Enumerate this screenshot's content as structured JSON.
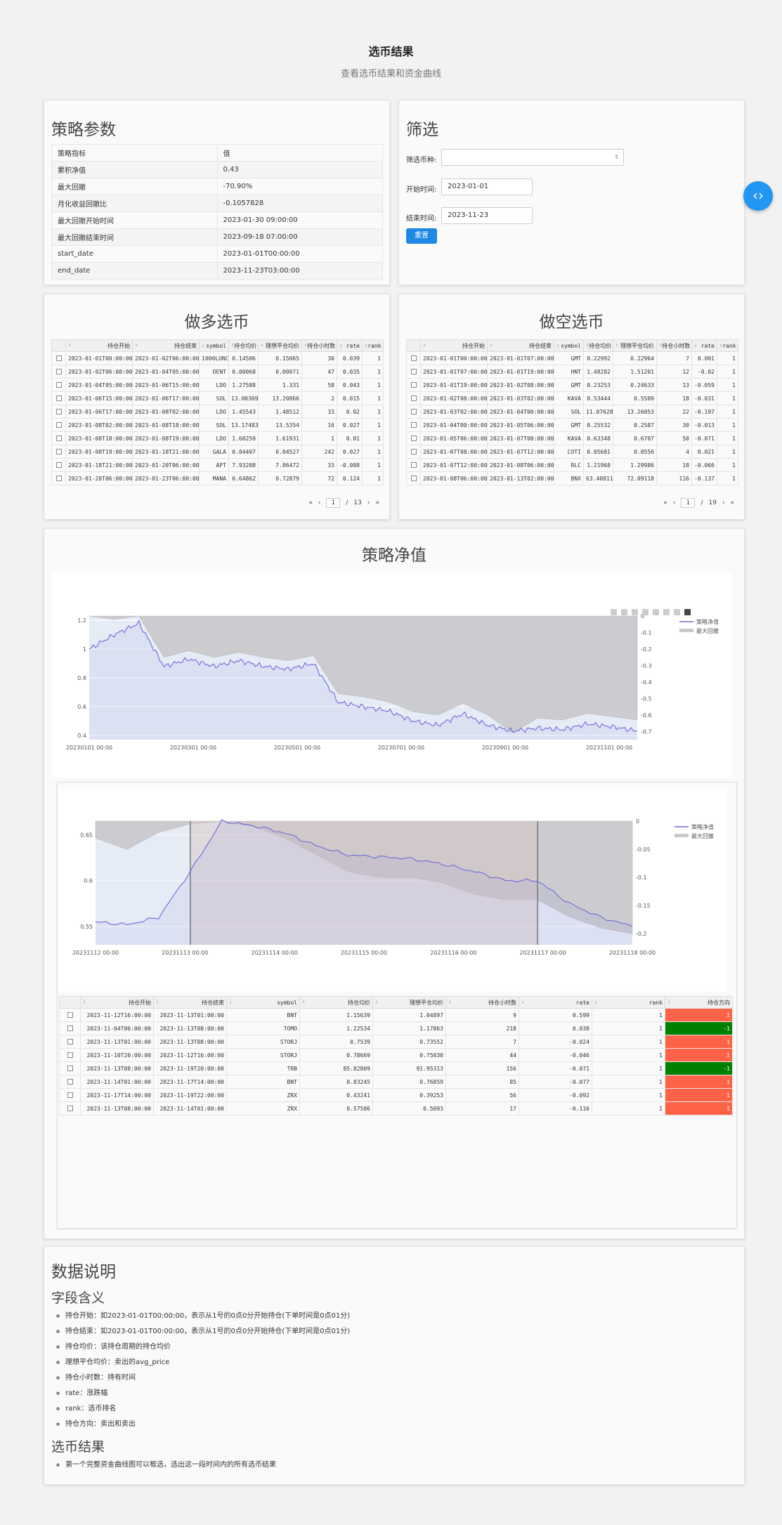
{
  "header": {
    "title": "选币结果",
    "subtitle": "查看选币结果和资金曲线"
  },
  "params": {
    "heading": "策略参数",
    "rows": [
      [
        "策略指标",
        "值"
      ],
      [
        "累积净值",
        "0.43"
      ],
      [
        "最大回撤",
        "-70.90%"
      ],
      [
        "月化收益回撤比",
        "-0.1057828"
      ],
      [
        "最大回撤开始时间",
        "2023-01-30 09:00:00"
      ],
      [
        "最大回撤结束时间",
        "2023-09-18 07:00:00"
      ],
      [
        "start_date",
        "2023-01-01T00:00:00"
      ],
      [
        "end_date",
        "2023-11-23T03:00:00"
      ]
    ]
  },
  "filter": {
    "heading": "筛选",
    "symbol_label": "筛选币种:",
    "symbol_value": "",
    "start_label": "开始时间:",
    "start_value": "2023-01-01",
    "end_label": "结束时间:",
    "end_value": "2023-11-23",
    "reset_label": "重置"
  },
  "table_columns": [
    "持仓开始",
    "持仓结束",
    "symbol",
    "持仓均价",
    "理想平仓均价",
    "持仓小时数",
    "rate",
    "rank"
  ],
  "long": {
    "heading": "做多选币",
    "rows": [
      [
        "2023-01-01T00:00:00",
        "2023-01-02T06:00:00",
        "1000LUNC",
        "0.14506",
        "0.15065",
        "30",
        "0.039",
        "1"
      ],
      [
        "2023-01-02T06:00:00",
        "2023-01-04T05:00:00",
        "DENT",
        "0.00068",
        "0.00071",
        "47",
        "0.035",
        "1"
      ],
      [
        "2023-01-04T05:00:00",
        "2023-01-06T15:00:00",
        "LDO",
        "1.27588",
        "1.331",
        "58",
        "0.043",
        "1"
      ],
      [
        "2023-01-06T15:00:00",
        "2023-01-06T17:00:00",
        "SOL",
        "13.00369",
        "13.20866",
        "2",
        "0.015",
        "1"
      ],
      [
        "2023-01-06T17:00:00",
        "2023-01-08T02:00:00",
        "LDO",
        "1.45543",
        "1.48512",
        "33",
        "0.02",
        "1"
      ],
      [
        "2023-01-08T02:00:00",
        "2023-01-08T18:00:00",
        "SOL",
        "13.17483",
        "13.5354",
        "16",
        "0.027",
        "1"
      ],
      [
        "2023-01-08T18:00:00",
        "2023-01-08T19:00:00",
        "LDO",
        "1.60259",
        "1.61931",
        "1",
        "0.01",
        "1"
      ],
      [
        "2023-01-08T19:00:00",
        "2023-01-18T21:00:00",
        "GALA",
        "0.04407",
        "0.04527",
        "242",
        "0.027",
        "1"
      ],
      [
        "2023-01-18T21:00:00",
        "2023-01-20T06:00:00",
        "APT",
        "7.93208",
        "7.86472",
        "33",
        "-0.008",
        "1"
      ],
      [
        "2023-01-20T06:00:00",
        "2023-01-23T06:00:00",
        "MANA",
        "0.64862",
        "0.72879",
        "72",
        "0.124",
        "1"
      ]
    ],
    "page": "1",
    "total_pages": "13"
  },
  "short": {
    "heading": "做空选币",
    "rows": [
      [
        "2023-01-01T00:00:00",
        "2023-01-01T07:00:00",
        "GMT",
        "0.22992",
        "0.22964",
        "7",
        "0.001",
        "1"
      ],
      [
        "2023-01-01T07:00:00",
        "2023-01-01T19:00:00",
        "HNT",
        "1.48282",
        "1.51201",
        "12",
        "-0.02",
        "1"
      ],
      [
        "2023-01-01T19:00:00",
        "2023-01-02T08:00:00",
        "GMT",
        "0.23253",
        "0.24633",
        "13",
        "-0.059",
        "1"
      ],
      [
        "2023-01-02T08:00:00",
        "2023-01-03T02:00:00",
        "KAVA",
        "0.53444",
        "0.5509",
        "18",
        "-0.031",
        "1"
      ],
      [
        "2023-01-03T02:00:00",
        "2023-01-04T00:00:00",
        "SOL",
        "11.07628",
        "13.26053",
        "22",
        "-0.197",
        "1"
      ],
      [
        "2023-01-04T00:00:00",
        "2023-01-05T06:00:00",
        "GMT",
        "0.25532",
        "0.2587",
        "30",
        "-0.013",
        "1"
      ],
      [
        "2023-01-05T06:00:00",
        "2023-01-07T08:00:00",
        "KAVA",
        "0.63348",
        "0.6707",
        "50",
        "-0.071",
        "1"
      ],
      [
        "2023-01-07T08:00:00",
        "2023-01-07T12:00:00",
        "COTI",
        "0.05681",
        "0.0556",
        "4",
        "0.021",
        "1"
      ],
      [
        "2023-01-07T12:00:00",
        "2023-01-08T06:00:00",
        "RLC",
        "1.21968",
        "1.29986",
        "18",
        "-0.066",
        "1"
      ],
      [
        "2023-01-08T06:00:00",
        "2023-01-13T02:00:00",
        "BNX",
        "63.40811",
        "72.09118",
        "116",
        "-0.137",
        "1"
      ]
    ],
    "page": "1",
    "total_pages": "19"
  },
  "pager": {
    "first": "«",
    "prev": "‹",
    "sep": "/",
    "next": "›",
    "last": "»"
  },
  "nav_toggle": "‹›",
  "equity": {
    "heading": "策略净值",
    "legend": [
      "策略净值",
      "最大回撤"
    ],
    "colors": {
      "nav": "#6b6bdc",
      "drawdown": "#c9c9cc",
      "highlight": "#d6c3c0",
      "plot_bg": "#e5ecf6"
    }
  },
  "chart_data": [
    {
      "type": "line",
      "x_ticks": [
        "20230101 00:00",
        "20230301 00:00",
        "20230501 00:00",
        "20230701 00:00",
        "20230901 00:00",
        "20231101 00:00"
      ],
      "y_ticks": [
        "1.2",
        "1",
        "0.8",
        "0.6",
        "0.4"
      ],
      "y2_ticks": [
        "0",
        "-0.1",
        "-0.2",
        "-0.3",
        "-0.4",
        "-0.5",
        "-0.6",
        "-0.7"
      ],
      "ylim": [
        0.37,
        1.23
      ],
      "y2lim": [
        -0.75,
        0
      ],
      "series": [
        {
          "name": "策略净值",
          "x": [
            "2023-01-01",
            "2023-01-15",
            "2023-01-30",
            "2023-02-15",
            "2023-03-01",
            "2023-03-20",
            "2023-04-05",
            "2023-04-20",
            "2023-05-05",
            "2023-05-20",
            "2023-06-01",
            "2023-06-15",
            "2023-07-01",
            "2023-07-15",
            "2023-08-01",
            "2023-08-15",
            "2023-09-01",
            "2023-09-18",
            "2023-10-01",
            "2023-10-15",
            "2023-11-01",
            "2023-11-15",
            "2023-11-23"
          ],
          "values": [
            1.0,
            1.1,
            1.18,
            0.88,
            0.93,
            0.88,
            0.92,
            0.88,
            0.86,
            0.9,
            0.63,
            0.6,
            0.57,
            0.5,
            0.47,
            0.55,
            0.47,
            0.43,
            0.45,
            0.44,
            0.48,
            0.46,
            0.43
          ]
        },
        {
          "name": "最大回撤",
          "x": [
            "2023-01-01",
            "2023-01-15",
            "2023-01-30",
            "2023-02-15",
            "2023-03-01",
            "2023-03-20",
            "2023-04-05",
            "2023-04-20",
            "2023-05-05",
            "2023-05-20",
            "2023-06-01",
            "2023-06-15",
            "2023-07-01",
            "2023-07-15",
            "2023-08-01",
            "2023-08-15",
            "2023-09-01",
            "2023-09-18",
            "2023-10-01",
            "2023-10-15",
            "2023-11-01",
            "2023-11-15",
            "2023-11-23"
          ],
          "values": [
            0,
            -0.02,
            0,
            -0.25,
            -0.21,
            -0.25,
            -0.22,
            -0.25,
            -0.27,
            -0.24,
            -0.47,
            -0.49,
            -0.52,
            -0.58,
            -0.6,
            -0.53,
            -0.6,
            -0.709,
            -0.62,
            -0.63,
            -0.59,
            -0.61,
            -0.63
          ]
        }
      ]
    },
    {
      "type": "line",
      "x_ticks": [
        "20231112 00:00",
        "20231113 00:00",
        "20231114 00:00",
        "20231115 00:00",
        "20231116 00:00",
        "20231117 00:00",
        "20231118 00:00"
      ],
      "y_ticks": [
        "0.65",
        "0.6",
        "0.55"
      ],
      "y2_ticks": [
        "0",
        "-0.05",
        "-0.1",
        "-0.15",
        "-0.2"
      ],
      "ylim": [
        0.53,
        0.665
      ],
      "y2lim": [
        -0.22,
        0
      ],
      "series": [
        {
          "name": "策略净值",
          "x": [
            "11-12 00",
            "11-12 12",
            "11-13 00",
            "11-13 02",
            "11-13 06",
            "11-13 12",
            "11-14 00",
            "11-14 12",
            "11-15 00",
            "11-15 12",
            "11-16 00",
            "11-16 12",
            "11-17 00",
            "11-17 12",
            "11-17 23",
            "11-18 00",
            "11-18 12",
            "11-18 22"
          ],
          "values": [
            0.555,
            0.552,
            0.56,
            0.61,
            0.665,
            0.66,
            0.652,
            0.638,
            0.628,
            0.626,
            0.624,
            0.618,
            0.61,
            0.6,
            0.6,
            0.575,
            0.56,
            0.55
          ]
        },
        {
          "name": "最大回撤",
          "x": [
            "11-12 00",
            "11-12 12",
            "11-13 00",
            "11-13 02",
            "11-13 06",
            "11-13 12",
            "11-14 00",
            "11-14 12",
            "11-15 00",
            "11-15 12",
            "11-16 00",
            "11-16 12",
            "11-17 00",
            "11-17 12",
            "11-17 23",
            "11-18 00",
            "11-18 12",
            "11-18 22"
          ],
          "values": [
            -0.03,
            -0.05,
            -0.02,
            -0.005,
            0,
            -0.01,
            -0.03,
            -0.06,
            -0.09,
            -0.1,
            -0.1,
            -0.11,
            -0.13,
            -0.14,
            -0.14,
            -0.17,
            -0.19,
            -0.2
          ]
        }
      ]
    }
  ],
  "zoom_table": {
    "columns": [
      "持仓开始",
      "持仓结束",
      "symbol",
      "持仓均价",
      "理想平仓均价",
      "持仓小时数",
      "rate",
      "rank",
      "持仓方向"
    ],
    "rows": [
      [
        "2023-11-12T16:00:00",
        "2023-11-13T01:00:00",
        "BNT",
        "1.15639",
        "1.04897",
        "9",
        "0.599",
        "1",
        "1"
      ],
      [
        "2023-11-04T06:00:00",
        "2023-11-13T08:00:00",
        "TOMO",
        "1.22534",
        "1.17863",
        "218",
        "0.038",
        "1",
        "-1"
      ],
      [
        "2023-11-13T01:00:00",
        "2023-11-13T08:00:00",
        "STORJ",
        "0.7539",
        "0.73552",
        "7",
        "-0.024",
        "1",
        "1"
      ],
      [
        "2023-11-10T20:00:00",
        "2023-11-12T16:00:00",
        "STORJ",
        "0.78669",
        "0.75030",
        "44",
        "-0.046",
        "1",
        "1"
      ],
      [
        "2023-11-13T08:00:00",
        "2023-11-19T20:00:00",
        "TRB",
        "85.82809",
        "91.95313",
        "156",
        "-0.071",
        "1",
        "-1"
      ],
      [
        "2023-11-14T01:00:00",
        "2023-11-17T14:00:00",
        "BNT",
        "0.83245",
        "0.76859",
        "85",
        "-0.077",
        "1",
        "1"
      ],
      [
        "2023-11-17T14:00:00",
        "2023-11-19T22:00:00",
        "ZRX",
        "0.43241",
        "0.39253",
        "56",
        "-0.092",
        "1",
        "1"
      ],
      [
        "2023-11-13T08:00:00",
        "2023-11-14T01:00:00",
        "ZRX",
        "0.57586",
        "0.5093",
        "17",
        "-0.116",
        "1",
        "1"
      ]
    ]
  },
  "doc": {
    "heading": "数据说明",
    "fields_heading": "字段含义",
    "fields": [
      "持仓开始：如2023-01-01T00:00:00，表示从1号的0点0分开始持仓(下单时间是0点01分)",
      "持仓结束：如2023-01-01T00:00:00，表示从1号的0点0分开始持仓(下单时间是0点01分)",
      "持仓均价：该持仓周期的持仓均价",
      "理想平仓均价：卖出的avg_price",
      "持仓小时数：持有时间",
      "rate：涨跌幅",
      "rank：选币排名",
      "持仓方向：卖出和卖出"
    ],
    "result_heading": "选币结果",
    "result_items": [
      "第一个完整资金曲线图可以框选，选出这一段时间内的所有选币结果"
    ]
  }
}
